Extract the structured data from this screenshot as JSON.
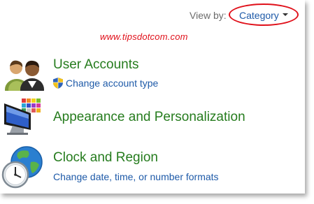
{
  "header": {
    "view_by_label": "View by:",
    "view_by_value": "Category"
  },
  "watermark": "www.tipsdotcom.com",
  "categories": [
    {
      "title": "User Accounts",
      "icon": "users-icon",
      "link": "Change account type",
      "link_icon": "shield-icon"
    },
    {
      "title": "Appearance and Personalization",
      "icon": "monitor-palette-icon"
    },
    {
      "title": "Clock and Region",
      "icon": "clock-globe-icon",
      "link": "Change date, time, or number formats"
    }
  ],
  "colors": {
    "title_green": "#267c1e",
    "link_blue": "#1e5aa8",
    "highlight_red": "#e0101a"
  }
}
